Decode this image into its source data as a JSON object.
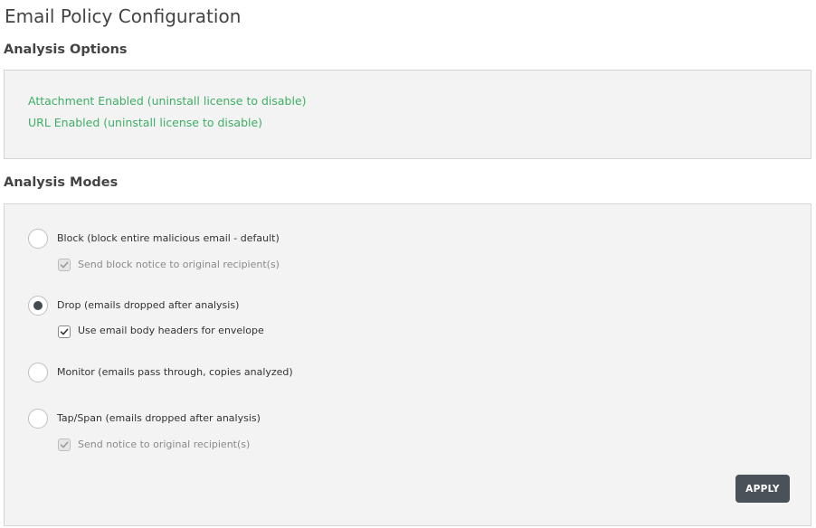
{
  "page": {
    "title": "Email Policy Configuration"
  },
  "analysis_options": {
    "title": "Analysis Options",
    "attachment_status": "Attachment Enabled (uninstall license to disable)",
    "url_status": "URL Enabled (uninstall license to disable)",
    "status_color": "#3fae68"
  },
  "analysis_modes": {
    "title": "Analysis Modes",
    "selected": "drop",
    "modes": [
      {
        "id": "block",
        "label": "Block (block entire malicious email - default)",
        "selected": false,
        "option": {
          "label": "Send block notice to original recipient(s)",
          "checked": true,
          "disabled": true
        }
      },
      {
        "id": "drop",
        "label": "Drop (emails dropped after analysis)",
        "selected": true,
        "option": {
          "label": "Use email body headers for envelope",
          "checked": true,
          "disabled": false
        }
      },
      {
        "id": "monitor",
        "label": "Monitor (emails pass through, copies analyzed)",
        "selected": false
      },
      {
        "id": "tap",
        "label": "Tap/Span (emails dropped after analysis)",
        "selected": false,
        "option": {
          "label": "Send notice to original recipient(s)",
          "checked": true,
          "disabled": true
        }
      }
    ],
    "apply_label": "APPLY"
  },
  "colors": {
    "button_bg": "#4a5158",
    "panel_bg": "#f3f3f3",
    "selected_dot": "#444b52"
  },
  "icons": {
    "checkmark": "check-icon",
    "radio_dot": "radio-selected-dot"
  }
}
